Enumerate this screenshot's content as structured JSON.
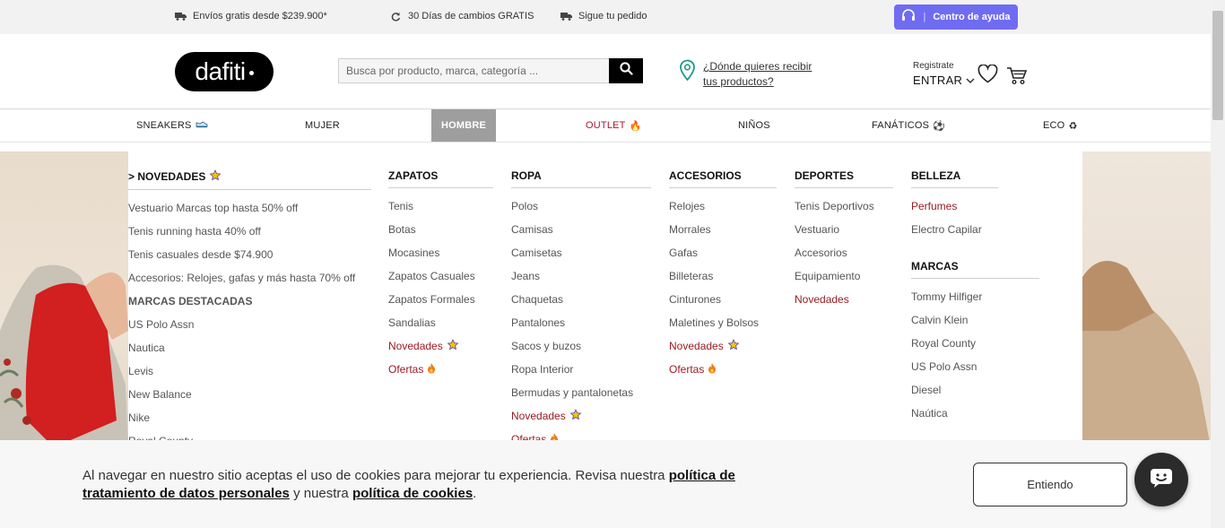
{
  "topbar": {
    "perks": [
      {
        "text": "Envíos gratis desde $239.900*",
        "icon": "truck-icon"
      },
      {
        "text": "30 Días de cambios GRATIS",
        "icon": "refresh-icon"
      },
      {
        "text": "Sigue tu pedido",
        "icon": "truck-icon"
      }
    ],
    "help_label": "Centro de ayuda",
    "help_separator": "|"
  },
  "header": {
    "logo_text": "dafiti",
    "search_placeholder": "Busca por producto, marca, categoría ...",
    "location_text": "¿Dónde quieres recibir tus productos?",
    "account_register": "Registrate",
    "account_enter": "ENTRAR"
  },
  "nav": {
    "items": [
      {
        "label": "SNEAKERS",
        "emoji": ""
      },
      {
        "label": "MUJER",
        "emoji": ""
      },
      {
        "label": "HOMBRE",
        "emoji": ""
      },
      {
        "label": "OUTLET",
        "emoji": "🔥"
      },
      {
        "label": "NIÑOS",
        "emoji": ""
      },
      {
        "label": "FANÁTICOS",
        "emoji": "⚽"
      },
      {
        "label": "ECO",
        "emoji": "♻"
      }
    ]
  },
  "menu": {
    "novedades": {
      "title": "> NOVEDADES",
      "links": [
        "Vestuario Marcas top hasta 50% off",
        "Tenis running hasta 40% off",
        "Tenis casuales desde $74.900",
        "Accesorios: Relojes, gafas y más hasta 70% off"
      ],
      "brands_title": "MARCAS DESTACADAS",
      "brands": [
        "US Polo Assn",
        "Nautica",
        "Levis",
        "New Balance",
        "Nike",
        "Royal County"
      ]
    },
    "zapatos": {
      "title": "ZAPATOS",
      "links": [
        "Tenis",
        "Botas",
        "Mocasines",
        "Zapatos Casuales",
        "Zapatos Formales",
        "Sandalias"
      ],
      "novedades": "Novedades",
      "ofertas": "Ofertas"
    },
    "ropa": {
      "title": "ROPA",
      "links": [
        "Polos",
        "Camisas",
        "Camisetas",
        "Jeans",
        "Chaquetas",
        "Pantalones",
        "Sacos y buzos",
        "Ropa Interior",
        "Bermudas y pantalonetas"
      ],
      "novedades": "Novedades",
      "ofertas": "Ofertas"
    },
    "accesorios": {
      "title": "ACCESORIOS",
      "links": [
        "Relojes",
        "Morrales",
        "Gafas",
        "Billeteras",
        "Cinturones",
        "Maletines y Bolsos"
      ],
      "novedades": "Novedades",
      "ofertas": "Ofertas"
    },
    "deportes": {
      "title": "DEPORTES",
      "links": [
        "Tenis Deportivos",
        "Vestuario",
        "Accesorios",
        "Equipamiento"
      ],
      "novedades": "Novedades"
    },
    "belleza": {
      "title": "BELLEZA",
      "perfumes": "Perfumes",
      "electro": "Electro Capilar",
      "brands_title": "MARCAS",
      "brands": [
        "Tommy Hilfiger",
        "Calvin Klein",
        "Royal County",
        "US Polo Assn",
        "Diesel",
        "Naútica"
      ]
    }
  },
  "cookie": {
    "text_1": "Al navegar en nuestro sitio aceptas el uso de cookies para mejorar tu experiencia. Revisa nuestra ",
    "link_1": "política de tratamiento de datos personales",
    "text_2": " y nuestra ",
    "link_2": "política de cookies",
    "text_3": ".",
    "accept_label": "Entiendo"
  },
  "colors": {
    "help_button": "#6f6cf2",
    "accent_red": "#9b1b24",
    "nav_active": "#9e9e9e"
  }
}
